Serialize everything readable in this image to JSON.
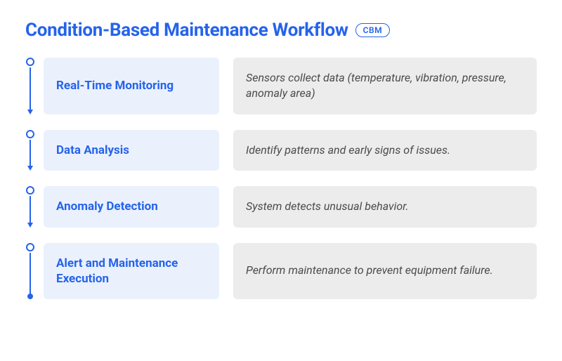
{
  "header": {
    "title": "Condition-Based Maintenance Workflow",
    "badge": "CBM"
  },
  "steps": [
    {
      "label": "Real-Time Monitoring",
      "desc": "Sensors collect data  (temperature, vibration, pressure, anomaly area)"
    },
    {
      "label": "Data Analysis",
      "desc": "Identify patterns and early signs of issues."
    },
    {
      "label": "Anomaly Detection",
      "desc": "System detects unusual behavior."
    },
    {
      "label": "Alert and Maintenance Execution",
      "desc": "Perform maintenance to prevent equipment failure."
    }
  ]
}
